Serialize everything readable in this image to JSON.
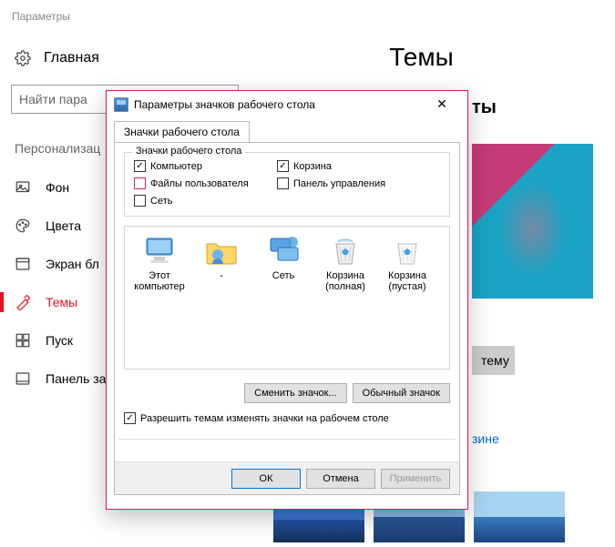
{
  "app_title": "Параметры",
  "home_label": "Главная",
  "search_placeholder": "Найти пара",
  "section_label": "Персонализац",
  "page_title": "Темы",
  "truncated_header_right": "ты",
  "nav": [
    {
      "id": "background",
      "label": "Фон"
    },
    {
      "id": "colors",
      "label": "Цвета"
    },
    {
      "id": "lock",
      "label": "Экран бл"
    },
    {
      "id": "themes",
      "label": "Темы",
      "active": true
    },
    {
      "id": "start",
      "label": "Пуск"
    },
    {
      "id": "taskbar",
      "label": "Панель за"
    }
  ],
  "theme_button_fragment": "тему",
  "link_fragment": "зине",
  "dialog": {
    "title": "Параметры значков рабочего стола",
    "tab": "Значки рабочего стола",
    "group_title": "Значки рабочего стола",
    "checks": {
      "computer": {
        "label": "Компьютер",
        "checked": true
      },
      "user_files": {
        "label": "Файлы пользователя",
        "checked": false
      },
      "network": {
        "label": "Сеть",
        "checked": false
      },
      "recycle": {
        "label": "Корзина",
        "checked": true
      },
      "control": {
        "label": "Панель управления",
        "checked": false
      }
    },
    "icons": [
      {
        "id": "this_pc",
        "label": "Этот компьютер",
        "kind": "pc"
      },
      {
        "id": "dash",
        "label": "-",
        "kind": "user"
      },
      {
        "id": "net",
        "label": "Сеть",
        "kind": "net"
      },
      {
        "id": "bin_full",
        "label": "Корзина (полная)",
        "kind": "bin_full"
      },
      {
        "id": "bin_empty",
        "label": "Корзина (пустая)",
        "kind": "bin_empty"
      }
    ],
    "change_icon": "Сменить значок...",
    "default_icon": "Обычный значок",
    "allow_themes": "Разрешить темам изменять значки на рабочем столе",
    "ok": "ОК",
    "cancel": "Отмена",
    "apply": "Применить"
  }
}
